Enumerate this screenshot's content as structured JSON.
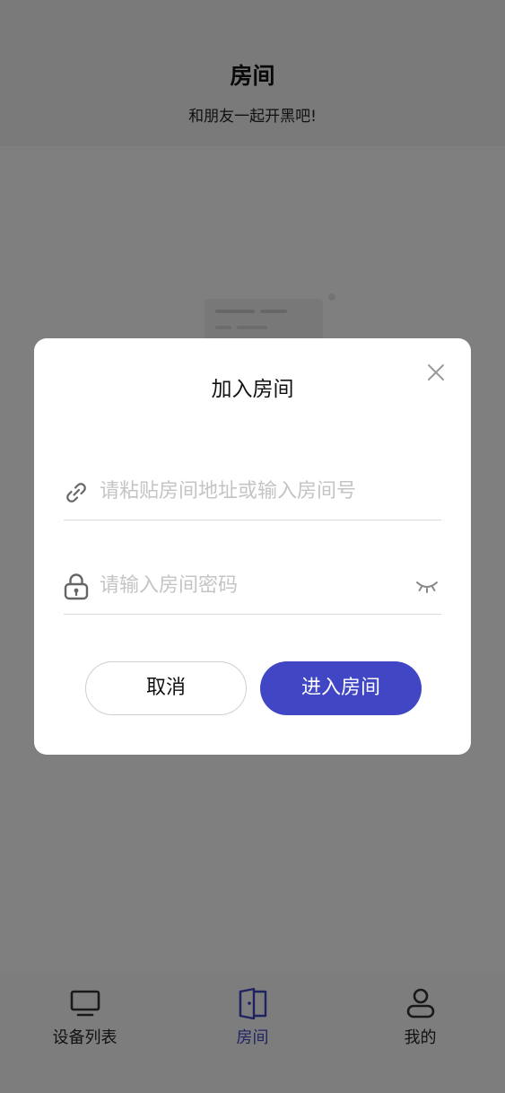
{
  "header": {
    "title": "房间",
    "subtitle": "和朋友一起开黑吧!"
  },
  "tabbar": {
    "items": [
      {
        "label": "设备列表",
        "icon": "monitor-icon"
      },
      {
        "label": "房间",
        "icon": "door-icon",
        "active": true
      },
      {
        "label": "我的",
        "icon": "user-icon"
      }
    ]
  },
  "dialog": {
    "title": "加入房间",
    "url_placeholder": "请粘贴房间地址或输入房间号",
    "url_value": "",
    "password_placeholder": "请输入房间密码",
    "password_value": "",
    "cancel_label": "取消",
    "confirm_label": "进入房间"
  },
  "colors": {
    "accent": "#4046c4",
    "overlay": "rgba(0,0,0,0.5)"
  }
}
